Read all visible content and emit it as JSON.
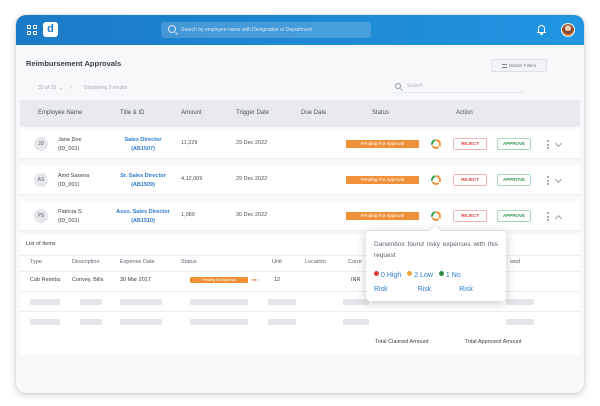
{
  "topbar": {
    "search_placeholder": "Search by employee name with Designation or Department",
    "logo_letter": "d",
    "icons": [
      "grid-icon",
      "bell-icon",
      "user-avatar"
    ]
  },
  "page": {
    "title": "Reimbursement Approvals",
    "filters_label": "Master Filters",
    "pager_text": "33 of 33",
    "displaying_text": "Displaying 3 results",
    "search_placeholder": "Search"
  },
  "table": {
    "headers": {
      "employee": "Employee Name",
      "title": "Title & ID",
      "amount": "Amount",
      "trigger": "Trigger Date",
      "due": "Due Date",
      "status": "Status",
      "action": "Action"
    },
    "rows": [
      {
        "initials": "JD",
        "name": "Jane Doe",
        "emp_id": "(ID_001)",
        "title": "Sales Director",
        "title_id": "(AB1507)",
        "amount": "11,229",
        "trigger_date": "29 Dec 2022",
        "status": "Pending For Approval",
        "reject": "REJECT",
        "approve": "APPROVE"
      },
      {
        "initials": "AS",
        "name": "Amit Saxena",
        "emp_id": "(ID_001)",
        "title": "Sr. Sales Director",
        "title_id": "(AB1509)",
        "amount": "4,12,009",
        "trigger_date": "29 Dec 2022",
        "status": "Pending For Approval",
        "reject": "REJECT",
        "approve": "APPROVE"
      },
      {
        "initials": "PS",
        "name": "Patricia S",
        "emp_id": "(ID_001)",
        "title": "Asso. Sales Director",
        "title_id": "(AB1510)",
        "amount": "1,089",
        "trigger_date": "30 Dec 2022",
        "status": "Pending For Approval",
        "reject": "REJECT",
        "approve": "APPROVE"
      }
    ]
  },
  "items": {
    "title": "List of Items",
    "headers": {
      "type": "Type",
      "description": "Description",
      "expense_date": "Expense Date",
      "status": "Status",
      "unit": "Unit",
      "location": "Location",
      "currency": "Curre",
      "approved": "wed"
    },
    "row": {
      "type": "Cab Reimbu",
      "description": "Convey. Bills",
      "expense_date": "30 Mar 2017",
      "status": "Pending For Approval",
      "unit": "12",
      "currency": "INR"
    },
    "total_claimed_label": "Total Claimed Amount",
    "total_approved_label": "Total Approved Amount"
  },
  "popover": {
    "text": "Darwinbox found risky expenses with this request",
    "high": "0 High",
    "low": "2 Low",
    "no": "1 No",
    "risk": "Risk"
  },
  "colors": {
    "primary": "#1b7ac6",
    "link": "#2b7bd0",
    "pending": "#f0913a",
    "reject": "#dc4545",
    "approve": "#2e9a4f",
    "risk_high": "#e03b3b",
    "risk_low": "#f0a23a",
    "risk_no": "#2e8a3c"
  }
}
